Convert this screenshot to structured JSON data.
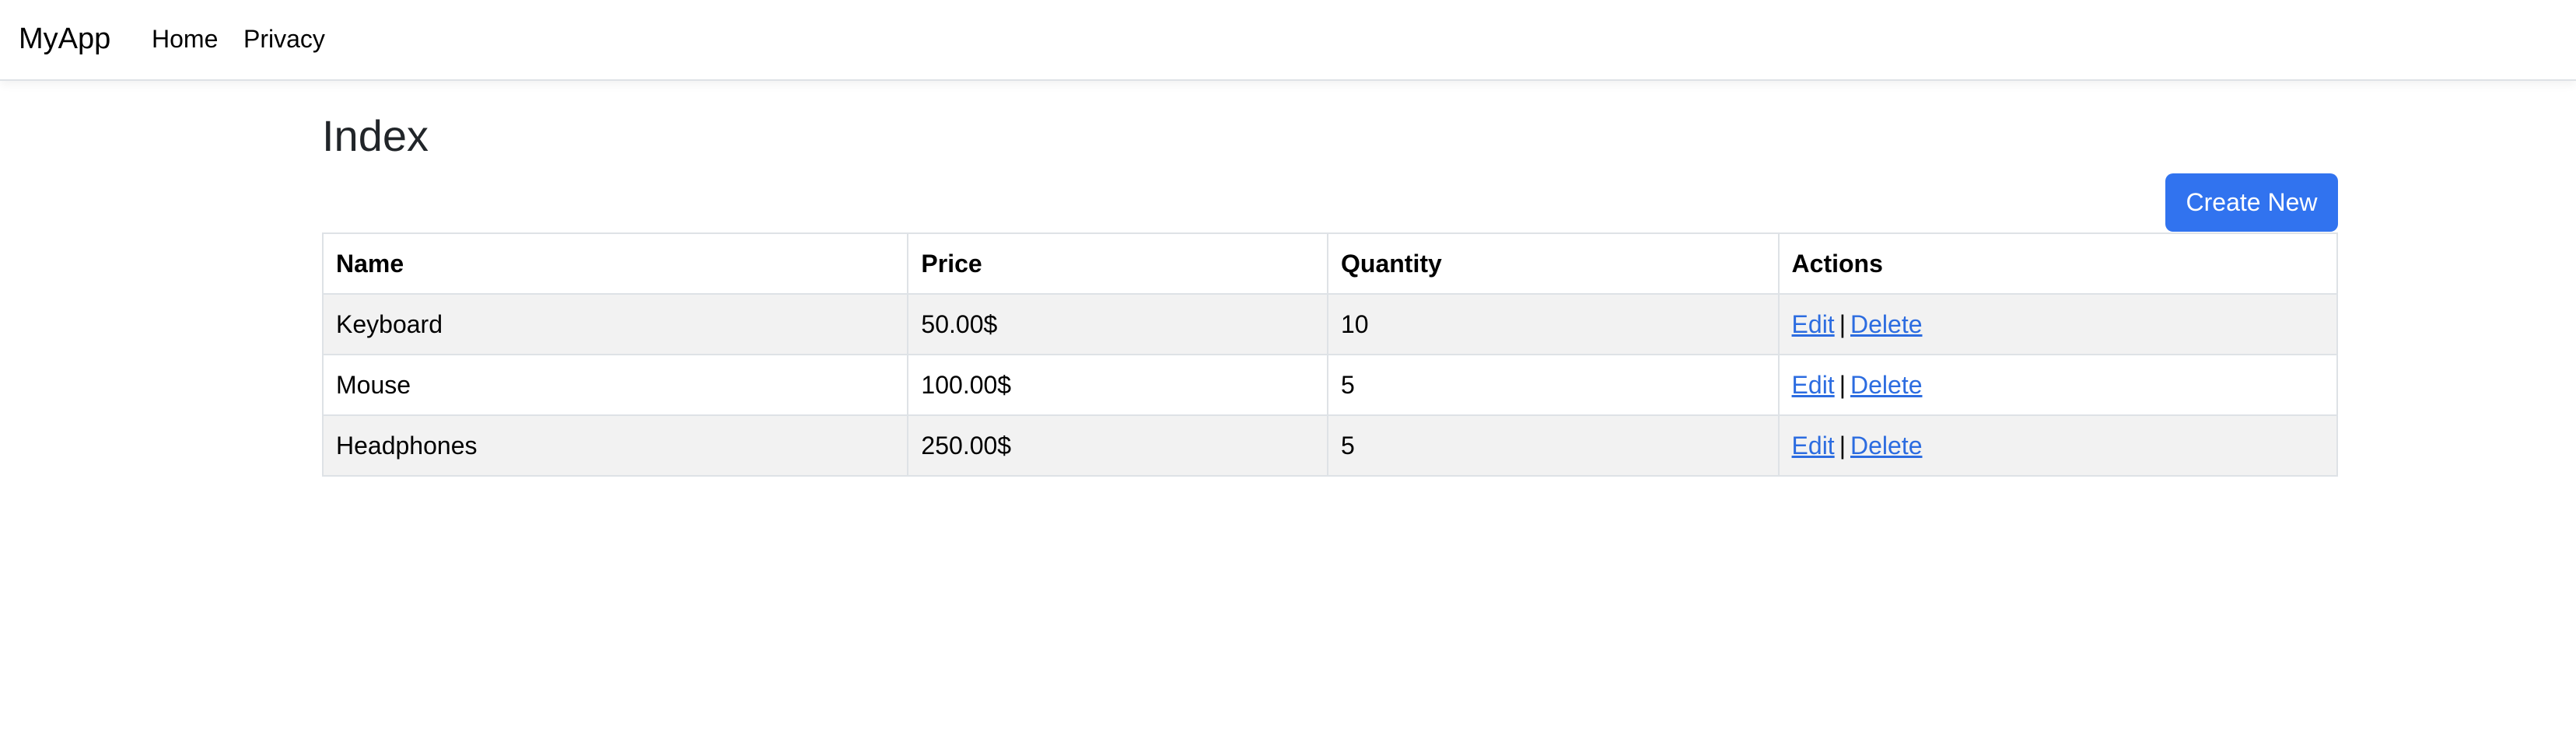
{
  "navbar": {
    "brand": "MyApp",
    "links": [
      {
        "label": "Home"
      },
      {
        "label": "Privacy"
      }
    ]
  },
  "main": {
    "title": "Index",
    "create_label": "Create New"
  },
  "table": {
    "headers": [
      "Name",
      "Price",
      "Quantity",
      "Actions"
    ],
    "rows": [
      {
        "name": "Keyboard",
        "price": "50.00$",
        "quantity": "10",
        "edit": "Edit",
        "separator": "|",
        "delete": "Delete"
      },
      {
        "name": "Mouse",
        "price": "100.00$",
        "quantity": "5",
        "edit": "Edit",
        "separator": "|",
        "delete": "Delete"
      },
      {
        "name": "Headphones",
        "price": "250.00$",
        "quantity": "5",
        "edit": "Edit",
        "separator": "|",
        "delete": "Delete"
      }
    ]
  },
  "colors": {
    "primary_button": "#3173ef",
    "link": "#2c6ce0",
    "striped_row": "#f2f2f2",
    "border": "#dee2e6"
  }
}
